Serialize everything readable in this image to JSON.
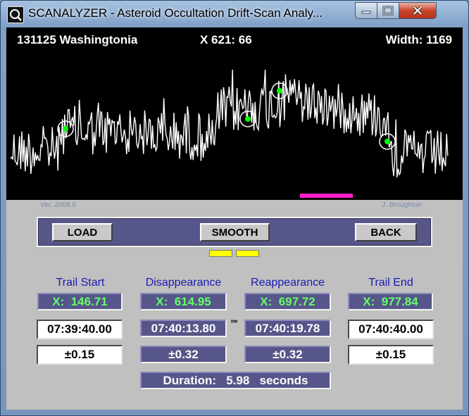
{
  "window": {
    "title": "SCANALYZER - Asteroid Occultation Drift-Scan Analy...",
    "controls": {
      "minimize": "minimize",
      "maximize": "maximize",
      "close": "close"
    }
  },
  "scope": {
    "label": "131125 Washingtonia",
    "cursor": "X 621: 66",
    "width": "Width: 1169",
    "trace_color": "#ffffff",
    "marker_color": "#00ff00",
    "bar_color": "#ff1ecb"
  },
  "credits": {
    "version": "Ver. 2008.6",
    "author": "J. Broughton"
  },
  "buttons": {
    "load": "LOAD",
    "smooth": "SMOOTH",
    "back": "BACK"
  },
  "columns": [
    {
      "label": "Trail Start",
      "x": "X:  146.71",
      "time": "07:39:40.00",
      "err": "±0.15"
    },
    {
      "label": "Disappearance",
      "x": "X:  614.95",
      "time": "07:40:13.80",
      "err": "±0.32"
    },
    {
      "label": "Reappearance",
      "x": "X:  697.72",
      "time": "07:40:19.78",
      "err": "±0.32"
    },
    {
      "label": "Trail End",
      "x": "X:  977.84",
      "time": "07:40:40.00",
      "err": "±0.15"
    }
  ],
  "time_unit_mark": "ᵐᵉ",
  "duration": "Duration:   5.98   seconds"
}
